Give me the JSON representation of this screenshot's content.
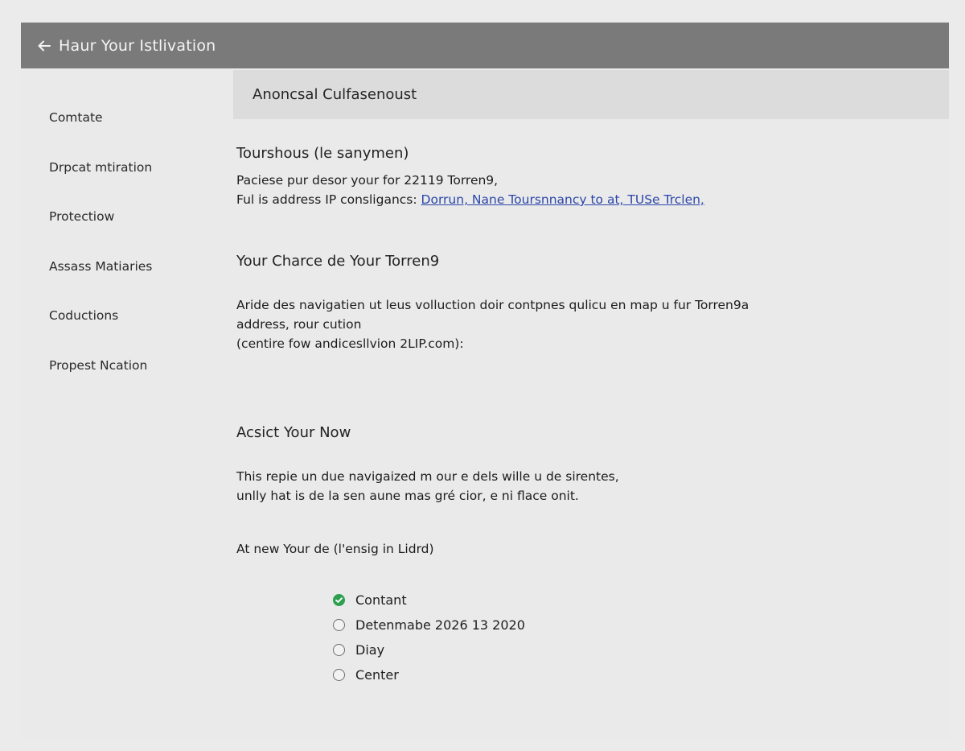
{
  "header": {
    "back_icon": "arrow-left-icon",
    "title": "Haur Your Istlivation"
  },
  "sidebar": {
    "items": [
      {
        "label": "Comtate"
      },
      {
        "label": "Drpcat mtiration"
      },
      {
        "label": "Protectiow"
      },
      {
        "label": "Assass Matiaries"
      },
      {
        "label": "Coductions"
      },
      {
        "label": "Propest Ncation"
      }
    ]
  },
  "main": {
    "header_title": "Anoncsal Culfasenoust",
    "section1": {
      "title": "Tourshous (le sanymen)",
      "line1": "Paciese pur desor your for 22119 Torren9,",
      "line2_prefix": "Ful is address IP consligancs: ",
      "line2_link": "Dorrun, Nane Toursnnancy to at, TUSe Trclen,"
    },
    "section2": {
      "title": "Your Charce de Your Torren9",
      "line1": "Aride des navigatien ut leus volluction doir contpnes qulicu en map u fur Torren9a",
      "line2": "address, rour cution",
      "line3": "(centire fow andicesllvion 2LIP.com):"
    },
    "section3": {
      "title": "Acsict Your Now",
      "line1": "This repie un due navigaized m our e dels wille u de sirentes,",
      "line2": "unlly hat is de la sen aune mas gré cior, e ni flace onit."
    },
    "options_prompt": "At new Your de (l'ensig in Lidrd)",
    "options": [
      {
        "label": "Contant",
        "checked": true
      },
      {
        "label": "Detenmabe 2026 13 2020",
        "checked": false
      },
      {
        "label": "Diay",
        "checked": false
      },
      {
        "label": "Center",
        "checked": false
      }
    ]
  },
  "colors": {
    "titlebar": "#7a7a7a",
    "background": "#eaeaea",
    "header_band": "#dcdcdc",
    "link": "#2b46a8",
    "radio_checked": "#2e9e4f"
  }
}
